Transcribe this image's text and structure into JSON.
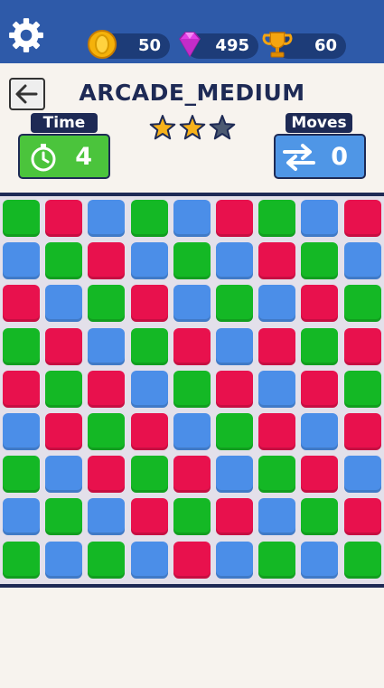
{
  "topbar": {
    "coins": "50",
    "gems": "495",
    "trophies": "60"
  },
  "level": {
    "title": "ARCADE_MEDIUM",
    "stars_earned": 2,
    "stars_total": 3
  },
  "stats": {
    "time_label": "Time",
    "time_value": "4",
    "moves_label": "Moves",
    "moves_value": "0"
  },
  "colors": {
    "green": "#14b825",
    "red": "#e8114d",
    "blue": "#4b8ee8",
    "topbar": "#2e5aa9",
    "navy": "#1e2a55"
  },
  "board": [
    [
      "green",
      "red",
      "blue",
      "green",
      "blue",
      "red",
      "green",
      "blue",
      "red"
    ],
    [
      "blue",
      "green",
      "red",
      "blue",
      "green",
      "blue",
      "red",
      "green",
      "blue"
    ],
    [
      "red",
      "blue",
      "green",
      "red",
      "blue",
      "green",
      "blue",
      "red",
      "green"
    ],
    [
      "green",
      "red",
      "blue",
      "green",
      "red",
      "blue",
      "red",
      "green",
      "red"
    ],
    [
      "red",
      "green",
      "red",
      "blue",
      "green",
      "red",
      "blue",
      "red",
      "green"
    ],
    [
      "blue",
      "red",
      "green",
      "red",
      "blue",
      "green",
      "red",
      "blue",
      "red"
    ],
    [
      "green",
      "blue",
      "red",
      "green",
      "red",
      "blue",
      "green",
      "red",
      "blue"
    ],
    [
      "blue",
      "green",
      "blue",
      "red",
      "green",
      "red",
      "blue",
      "green",
      "red"
    ],
    [
      "green",
      "blue",
      "green",
      "blue",
      "red",
      "blue",
      "green",
      "blue",
      "green"
    ]
  ]
}
